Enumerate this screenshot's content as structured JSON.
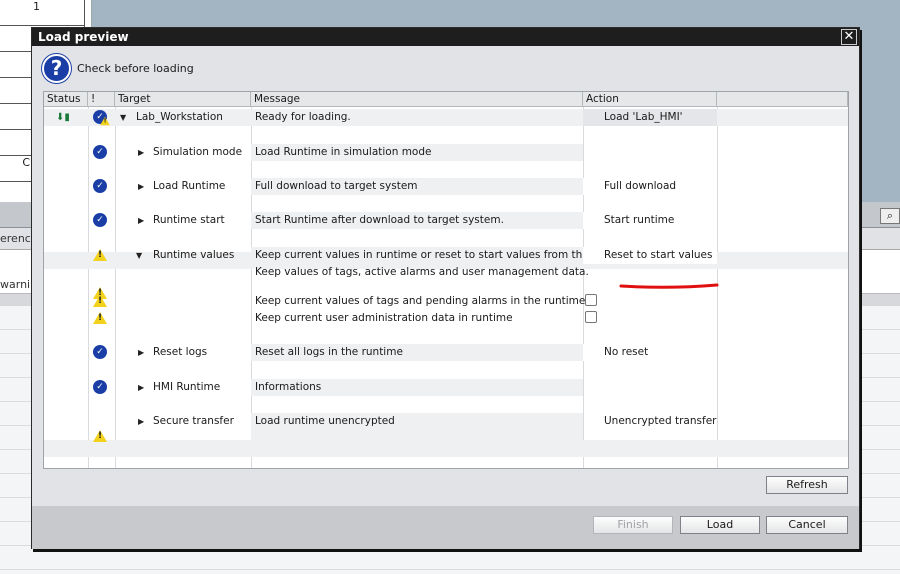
{
  "background": {
    "cell_value": "1",
    "clipped_text_1": "erenc",
    "clipped_text_2": "warnir",
    "clipped_text_3": "C",
    "search_icon": "magnifier-icon"
  },
  "dialog": {
    "title": "Load preview",
    "close_glyph": "✕",
    "header_text": "Check before loading",
    "header_glyph": "?",
    "columns": {
      "status": "Status",
      "warn": "!",
      "target": "Target",
      "message": "Message",
      "action": "Action"
    },
    "rows": {
      "workstation": {
        "target": "Lab_Workstation",
        "message": "Ready for loading.",
        "action": "Load 'Lab_HMI'"
      },
      "simulation": {
        "target": "Simulation mode",
        "message": "Load Runtime in simulation mode",
        "action": ""
      },
      "load_runtime": {
        "target": "Load Runtime",
        "message": "Full download to target system",
        "action": "Full download"
      },
      "runtime_start": {
        "target": "Runtime start",
        "message": "Start Runtime after download to target system.",
        "action": "Start runtime"
      },
      "runtime_values": {
        "target": "Runtime values",
        "message": "Keep current values in runtime or reset to start values from the en",
        "action": "Reset to start values"
      },
      "runtime_values_info": {
        "message": "Keep values of tags, active alarms and user management data."
      },
      "keep_tags": {
        "message": "Keep current values of tags and pending alarms in the runtime",
        "checked": false
      },
      "keep_users": {
        "message": "Keep current user administration data in runtime",
        "checked": false
      },
      "reset_logs": {
        "target": "Reset logs",
        "message": "Reset all logs in the runtime",
        "action": "No reset"
      },
      "hmi_runtime": {
        "target": "HMI Runtime",
        "message": "Informations",
        "action": ""
      },
      "secure_transfer": {
        "target": "Secure transfer",
        "message": "Load runtime unencrypted",
        "action": "Unencrypted transfer"
      }
    },
    "refresh_label": "Refresh",
    "finish_label": "Finish",
    "load_label": "Load",
    "cancel_label": "Cancel",
    "colors": {
      "accent": "#1b3ea6",
      "warning": "#f2d21d",
      "annotation": "#e01010",
      "titlebar": "#1e1e1e"
    }
  }
}
